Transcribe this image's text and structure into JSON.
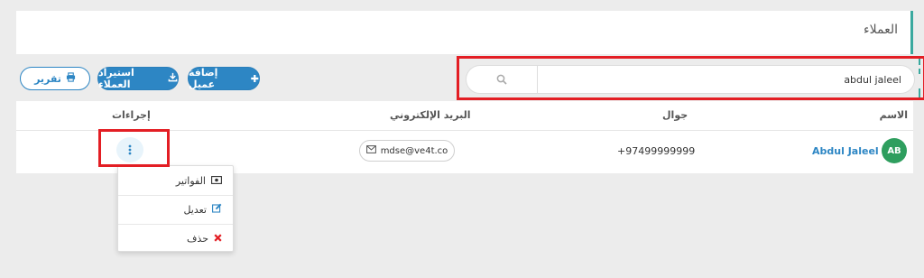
{
  "page": {
    "title": "العملاء"
  },
  "toolbar": {
    "add_customer": "إضافة عميل",
    "import_customers": "استيراد العملاء",
    "report": "تقرير"
  },
  "search": {
    "value": "abdul jaleel",
    "icon": "search-icon"
  },
  "table": {
    "headers": {
      "name": "الاسم",
      "mobile": "جوال",
      "email": "البريد الإلكتروني",
      "actions": "إجراءات"
    },
    "rows": [
      {
        "initials": "AB",
        "name": "Abdul Jaleel",
        "mobile": "+97499999999",
        "email": "mdse@ve4t.co"
      }
    ]
  },
  "actions_menu": {
    "items": [
      {
        "label": "الفواتير",
        "icon": "invoice-icon"
      },
      {
        "label": "تعديل",
        "icon": "edit-icon"
      },
      {
        "label": "حذف",
        "icon": "delete-icon"
      }
    ]
  },
  "colors": {
    "accent": "#3aa99f",
    "primary": "#2d86c4",
    "avatar": "#2e9e5e",
    "danger": "#e31e24"
  }
}
